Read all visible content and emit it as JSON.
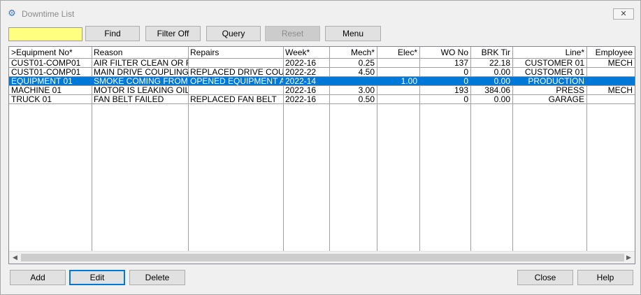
{
  "window": {
    "title": "Downtime List",
    "close_glyph": "✕",
    "app_icon": "gear-icon"
  },
  "toolbar": {
    "search_value": "",
    "find": "Find",
    "filter_off": "Filter Off",
    "query": "Query",
    "reset": "Reset",
    "menu": "Menu"
  },
  "table": {
    "headers": [
      ">Equipment No*",
      "Reason",
      "Repairs",
      "Week*",
      "Mech*",
      "Elec*",
      "WO No",
      "BRK Tir",
      "Line*",
      "Employee"
    ],
    "rows": [
      [
        "CUST01-COMP01",
        "AIR FILTER CLEAN OR REP",
        "",
        "2022-16",
        "0.25",
        "",
        "137",
        "22.18",
        "CUSTOMER 01",
        "MECH"
      ],
      [
        "CUST01-COMP01",
        "MAIN DRIVE COUPLING F",
        "REPLACED DRIVE COUPL",
        "2022-22",
        "4.50",
        "",
        "0",
        "0.00",
        "CUSTOMER 01",
        ""
      ],
      [
        "EQUIPMENT 01",
        "SMOKE COMING FROM T",
        "OPENED EQUIPMENT AN",
        "2022-14",
        "",
        "1.00",
        "0",
        "0.00",
        "PRODUCTION",
        ""
      ],
      [
        "MACHINE 01",
        "MOTOR IS LEAKING OIL O",
        "",
        "2022-16",
        "3.00",
        "",
        "193",
        "384.06",
        "PRESS",
        "MECH"
      ],
      [
        "TRUCK 01",
        "FAN BELT FAILED",
        "REPLACED FAN BELT",
        "2022-16",
        "0.50",
        "",
        "0",
        "0.00",
        "GARAGE",
        ""
      ]
    ],
    "selected_row": 2
  },
  "footer": {
    "add": "Add",
    "edit": "Edit",
    "delete": "Delete",
    "close": "Close",
    "help": "Help"
  },
  "colors": {
    "search_bg": "#ffff80",
    "selection": "#0078d7",
    "focus_border": "#0078d7"
  }
}
